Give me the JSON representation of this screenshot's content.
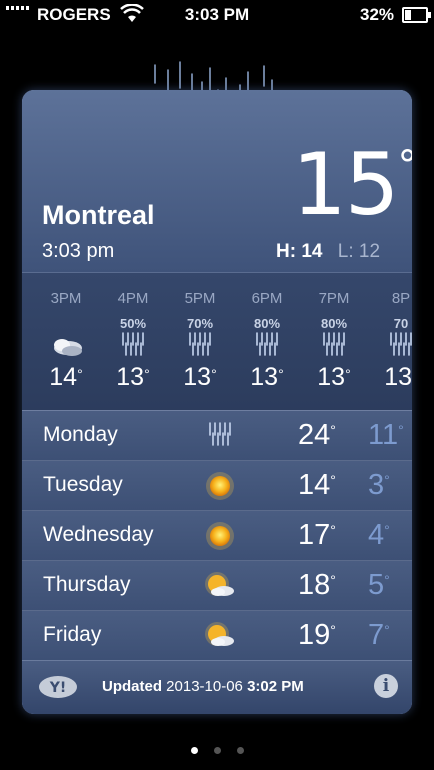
{
  "status": {
    "carrier": "ROGERS",
    "time": "3:03 PM",
    "battery": "32%",
    "battery_level": 0.32
  },
  "weather": {
    "city": "Montreal",
    "local_time": "3:03 pm",
    "current_temp": "15",
    "hi_label": "H: 14",
    "lo_label": "L: 12"
  },
  "hourly": [
    {
      "label": "3PM",
      "pct": "",
      "icon": "partly-cloudy-icon",
      "temp": "14"
    },
    {
      "label": "4PM",
      "pct": "50%",
      "icon": "rain-icon",
      "temp": "13"
    },
    {
      "label": "5PM",
      "pct": "70%",
      "icon": "rain-icon",
      "temp": "13"
    },
    {
      "label": "6PM",
      "pct": "80%",
      "icon": "rain-icon",
      "temp": "13"
    },
    {
      "label": "7PM",
      "pct": "80%",
      "icon": "rain-icon",
      "temp": "13"
    },
    {
      "label": "8P",
      "pct": "70",
      "icon": "rain-icon",
      "temp": "13"
    }
  ],
  "daily": [
    {
      "day": "Monday",
      "icon": "rain-icon",
      "hi": "24",
      "lo": "11"
    },
    {
      "day": "Tuesday",
      "icon": "sun-icon",
      "hi": "14",
      "lo": "3"
    },
    {
      "day": "Wednesday",
      "icon": "sun-icon",
      "hi": "17",
      "lo": "4"
    },
    {
      "day": "Thursday",
      "icon": "partly-sunny-icon",
      "hi": "18",
      "lo": "5"
    },
    {
      "day": "Friday",
      "icon": "partly-sunny-icon",
      "hi": "19",
      "lo": "7"
    }
  ],
  "footer": {
    "updated_label": "Updated",
    "updated_date": "2013-10-06",
    "updated_time": "3:02 PM",
    "yahoo_logo": "Y!",
    "info_glyph": "i"
  },
  "pages": {
    "count": 3,
    "active": 0
  }
}
